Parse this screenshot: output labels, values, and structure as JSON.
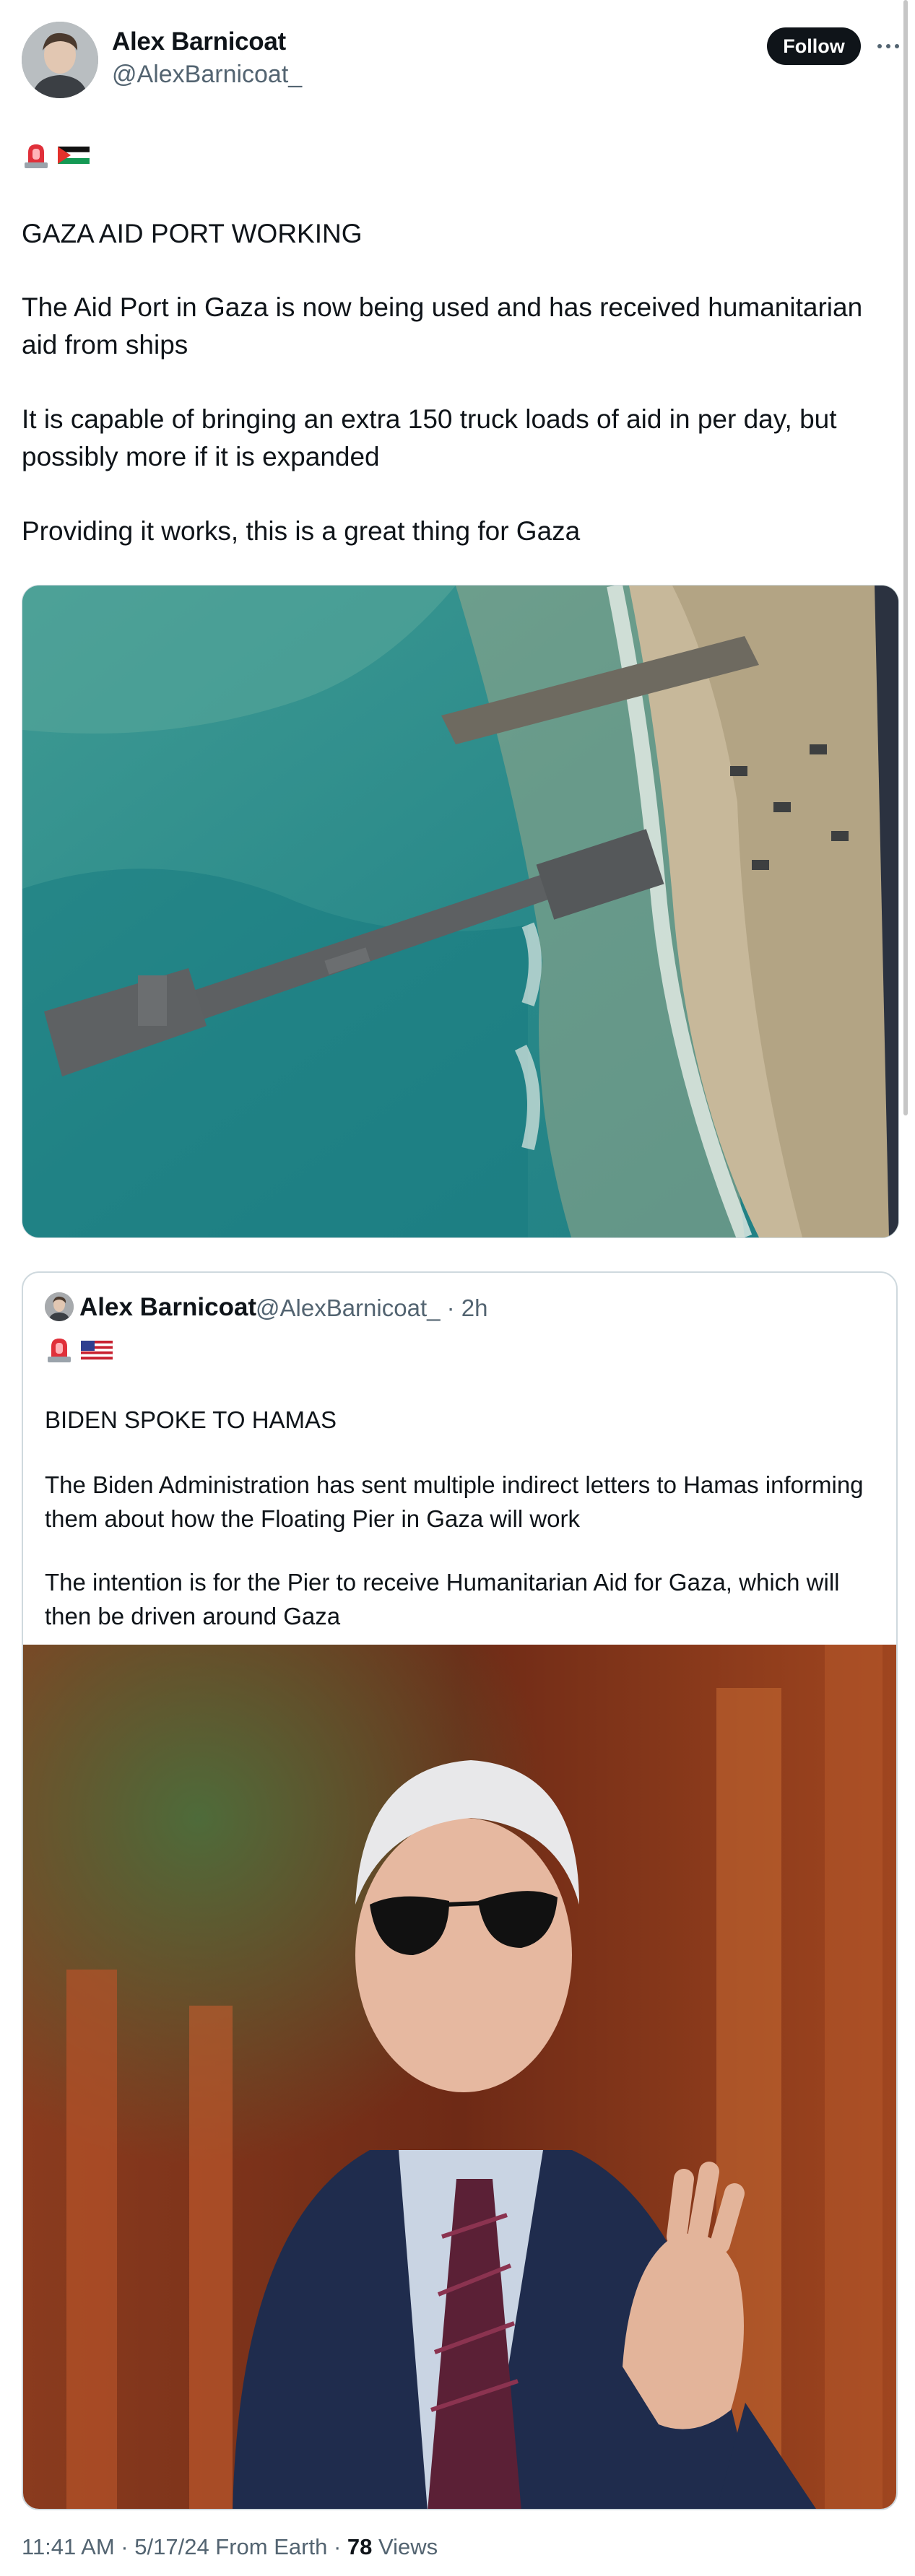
{
  "author": {
    "name": "Alex Barnicoat",
    "handle": "@AlexBarnicoat_",
    "follow_label": "Follow"
  },
  "tweet": {
    "emojis": [
      "police-light-emoji",
      "palestine-flag-emoji"
    ],
    "paragraphs": [
      "GAZA AID PORT WORKING",
      "The Aid Port in Gaza is now being used and has received humanitarian aid from ships",
      "It is capable of bringing an extra 150 truck loads of aid in per day, but possibly more if it is expanded",
      "Providing it works, this is a great thing for Gaza"
    ]
  },
  "quote": {
    "name": "Alex Barnicoat",
    "handle_time": "@AlexBarnicoat_ · 2h",
    "emojis": [
      "police-light-emoji",
      "us-flag-emoji"
    ],
    "paragraphs": [
      "BIDEN SPOKE TO HAMAS",
      "The Biden Administration has sent multiple indirect letters to Hamas informing them about how the Floating Pier in Gaza will work",
      "The intention is for the Pier to receive Humanitarian Aid for Gaza, which will then be driven around Gaza"
    ]
  },
  "meta": {
    "time": "11:41 AM",
    "sep1": " · ",
    "date": "5/17/24",
    "source": " From Earth",
    "sep2": " · ",
    "views_count": "78",
    "views_label": " Views"
  },
  "colors": {
    "text": "#0f1419",
    "secondary": "#536471",
    "border": "#cfd9de",
    "follow_bg": "#0f1419"
  }
}
